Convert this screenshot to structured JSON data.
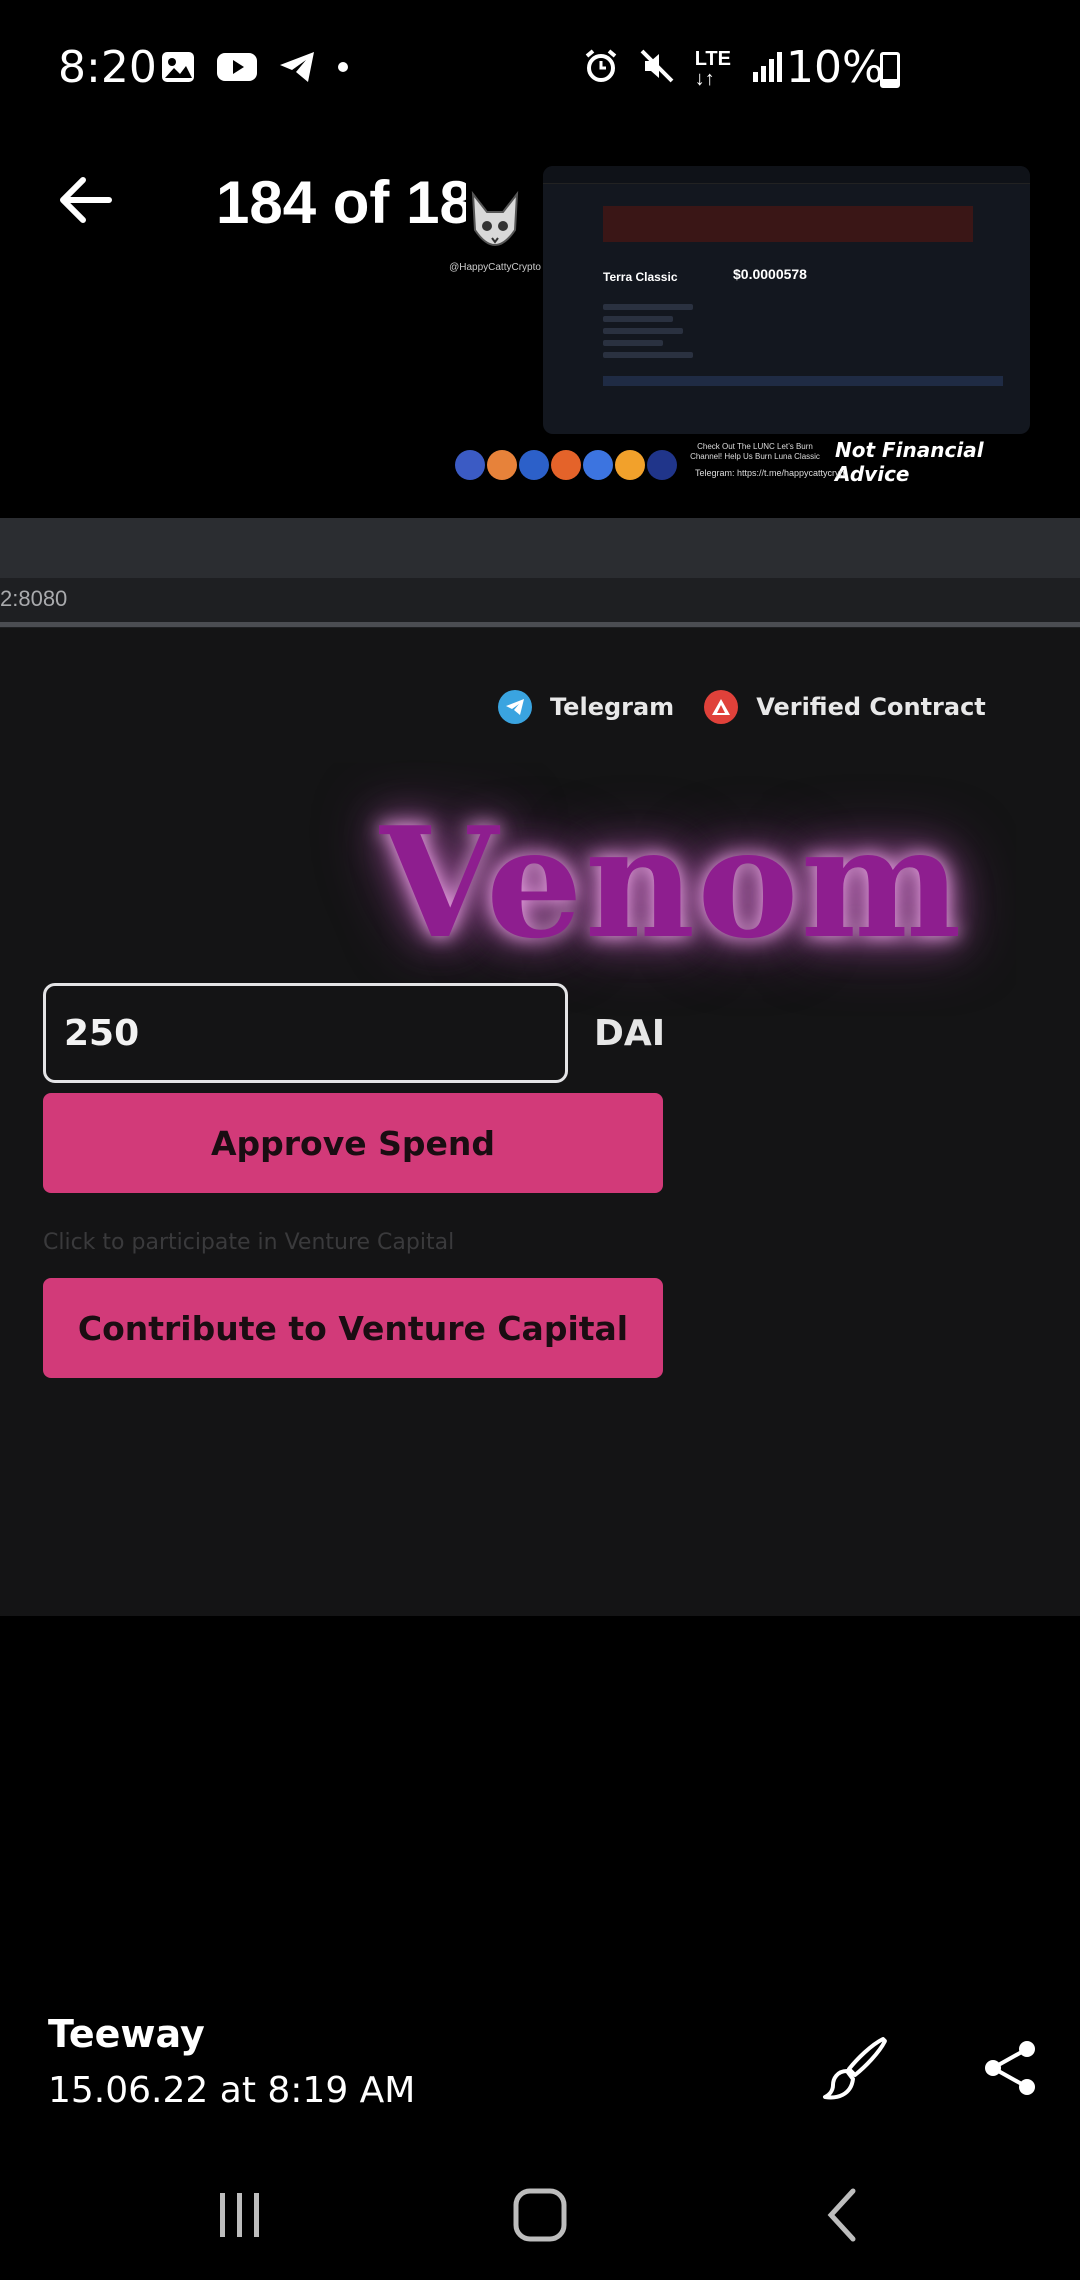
{
  "status_bar": {
    "time": "8:20",
    "battery": "10%",
    "network": "LTE",
    "icons": [
      "gallery-icon",
      "youtube-icon",
      "telegram-icon",
      "dot-icon",
      "alarm-icon",
      "mute-icon",
      "lte-icon",
      "signal-icon",
      "battery-charging-icon"
    ]
  },
  "header": {
    "counter": "184 of 18",
    "back_icon": "arrow-left-icon"
  },
  "thumbnail": {
    "watermark": "@HappyCattyCrypto",
    "coin_name": "Terra Classic",
    "price": "$0.0000578",
    "disclaimer": "Not Financial Advice",
    "promo": "Check Out The LUNC Let’s Burn Channel! Help Us Burn Luna Classic",
    "telegram": "Telegram: https://t.me/happycattycryp"
  },
  "screen": {
    "url": "2:8080",
    "links": {
      "telegram": "Telegram",
      "verified": "Verified Contract"
    },
    "brand": "Venom",
    "amount_value": "250",
    "currency": "DAI",
    "approve_label": "Approve Spend",
    "hint": "Click to participate in Venture Capital",
    "contribute_label": "Contribute to Venture Capital"
  },
  "footer": {
    "author": "Teeway",
    "date": "15.06.22 at 8:19 AM"
  },
  "colors": {
    "accent_pink": "#d23a79",
    "venom_purple": "#8e1e8f",
    "telegram_blue": "#3aa4e0",
    "verified_red": "#e0413a"
  }
}
